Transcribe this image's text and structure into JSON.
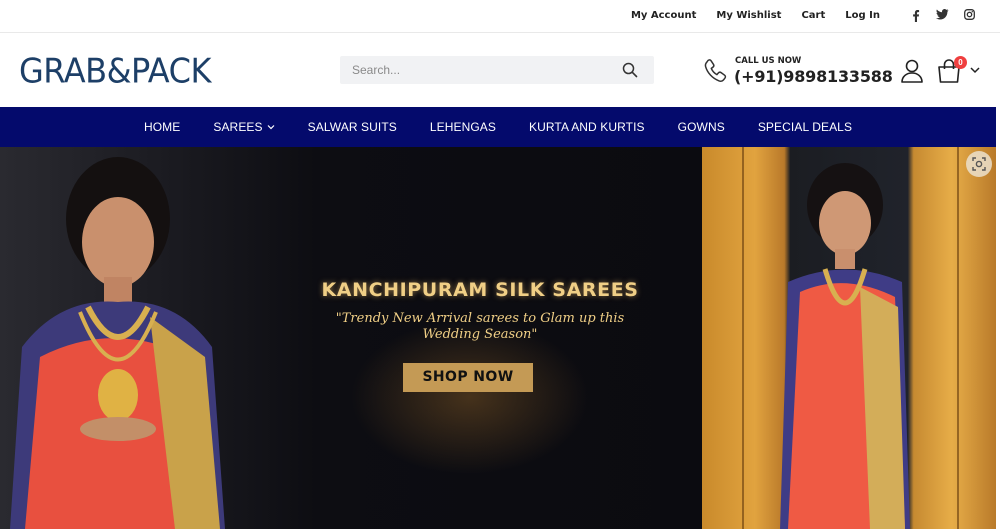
{
  "topbar": {
    "links": [
      "My Account",
      "My Wishlist",
      "Cart",
      "Log In"
    ],
    "social_icons": [
      "facebook-icon",
      "twitter-icon",
      "instagram-icon"
    ]
  },
  "header": {
    "logo": "GRAB&PACK",
    "search": {
      "placeholder": "Search..."
    },
    "call_label": "CALL US NOW",
    "call_number": "(+91)9898133588",
    "cart_count": "0"
  },
  "nav": {
    "items": [
      "HOME",
      "SAREES",
      "SALWAR SUITS",
      "LEHENGAS",
      "KURTA AND KURTIS",
      "GOWNS",
      "SPECIAL DEALS"
    ]
  },
  "banner": {
    "title": "KANCHIPURAM SILK SAREES",
    "subtitle_line1": "\"Trendy New Arrival sarees to Glam up this",
    "subtitle_line2": "Wedding Season\"",
    "cta": "SHOP NOW"
  },
  "colors": {
    "nav_bg": "#040a6c",
    "logo": "#1d3f67",
    "banner_text": "#f0cf86",
    "cta_bg": "#c49a55",
    "badge": "#ef3f3f"
  }
}
